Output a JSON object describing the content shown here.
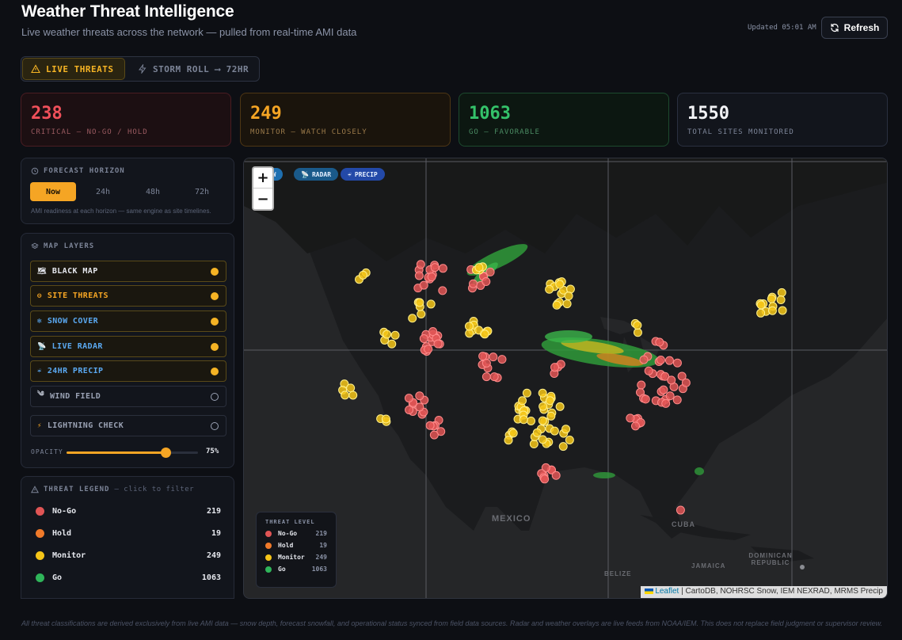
{
  "header": {
    "title": "Weather Threat Intelligence",
    "subtitle": "Live weather threats across the network — pulled from real-time AMI data",
    "updated": "Updated 05:01 AM",
    "refresh_label": "Refresh"
  },
  "tabs": {
    "live": "LIVE THREATS",
    "storm": "STORM ROLL ⟶ 72HR"
  },
  "stats": [
    {
      "value": "238",
      "label": "CRITICAL — NO-GO / HOLD"
    },
    {
      "value": "249",
      "label": "MONITOR — WATCH CLOSELY"
    },
    {
      "value": "1063",
      "label": "GO — FAVORABLE"
    },
    {
      "value": "1550",
      "label": "TOTAL SITES MONITORED"
    }
  ],
  "horizon": {
    "heading": "FORECAST HORIZON",
    "options": [
      "Now",
      "24h",
      "48h",
      "72h"
    ],
    "selected": "Now",
    "note": "AMI readiness at each horizon — same engine as site timelines."
  },
  "layers": {
    "heading": "MAP LAYERS",
    "items": [
      {
        "label": "BLACK MAP",
        "on": true,
        "color": "#e6e8ee"
      },
      {
        "label": "SITE THREATS",
        "on": true,
        "color": "#f5a524"
      },
      {
        "label": "SNOW COVER",
        "on": true,
        "color": "#5aa8f0"
      },
      {
        "label": "LIVE RADAR",
        "on": true,
        "color": "#5aa8f0"
      },
      {
        "label": "24HR PRECIP",
        "on": true,
        "color": "#5aa8f0"
      },
      {
        "label": "WIND FIELD",
        "on": false,
        "color": "#9aa2b4"
      },
      {
        "label": "LIGHTNING CHECK",
        "on": false,
        "color": "#9aa2b4"
      }
    ],
    "opacity_label": "OPACITY",
    "opacity_value": "75%",
    "opacity_fraction": 0.75
  },
  "threat_legend": {
    "heading": "THREAT LEGEND",
    "hint": "— click to filter",
    "items": [
      {
        "label": "No-Go",
        "count": "219",
        "color": "#e05555"
      },
      {
        "label": "Hold",
        "count": "19",
        "color": "#f07a2a"
      },
      {
        "label": "Monitor",
        "count": "249",
        "color": "#f5c518"
      },
      {
        "label": "Go",
        "count": "1063",
        "color": "#2fb55a"
      }
    ]
  },
  "map": {
    "chips": [
      "NOW",
      "RADAR",
      "PRECIP"
    ],
    "zoom_in": "+",
    "zoom_out": "−",
    "legend_heading": "THREAT LEVEL",
    "places": [
      "MEXICO",
      "CUBA",
      "BELIZE",
      "JAMAICA",
      "DOMINICAN REPUBLIC"
    ],
    "attribution_link": "Leaflet",
    "attribution_text": "| CartoDB, NOHRSC Snow, IEM NEXRAD, MRMS Precip"
  },
  "footer": "All threat classifications are derived exclusively from live AMI data — snow depth, forecast snowfall, and operational status synced from field data sources. Radar and weather overlays are live feeds from NOAA/IEM. This does not replace field judgment or supervisor review."
}
